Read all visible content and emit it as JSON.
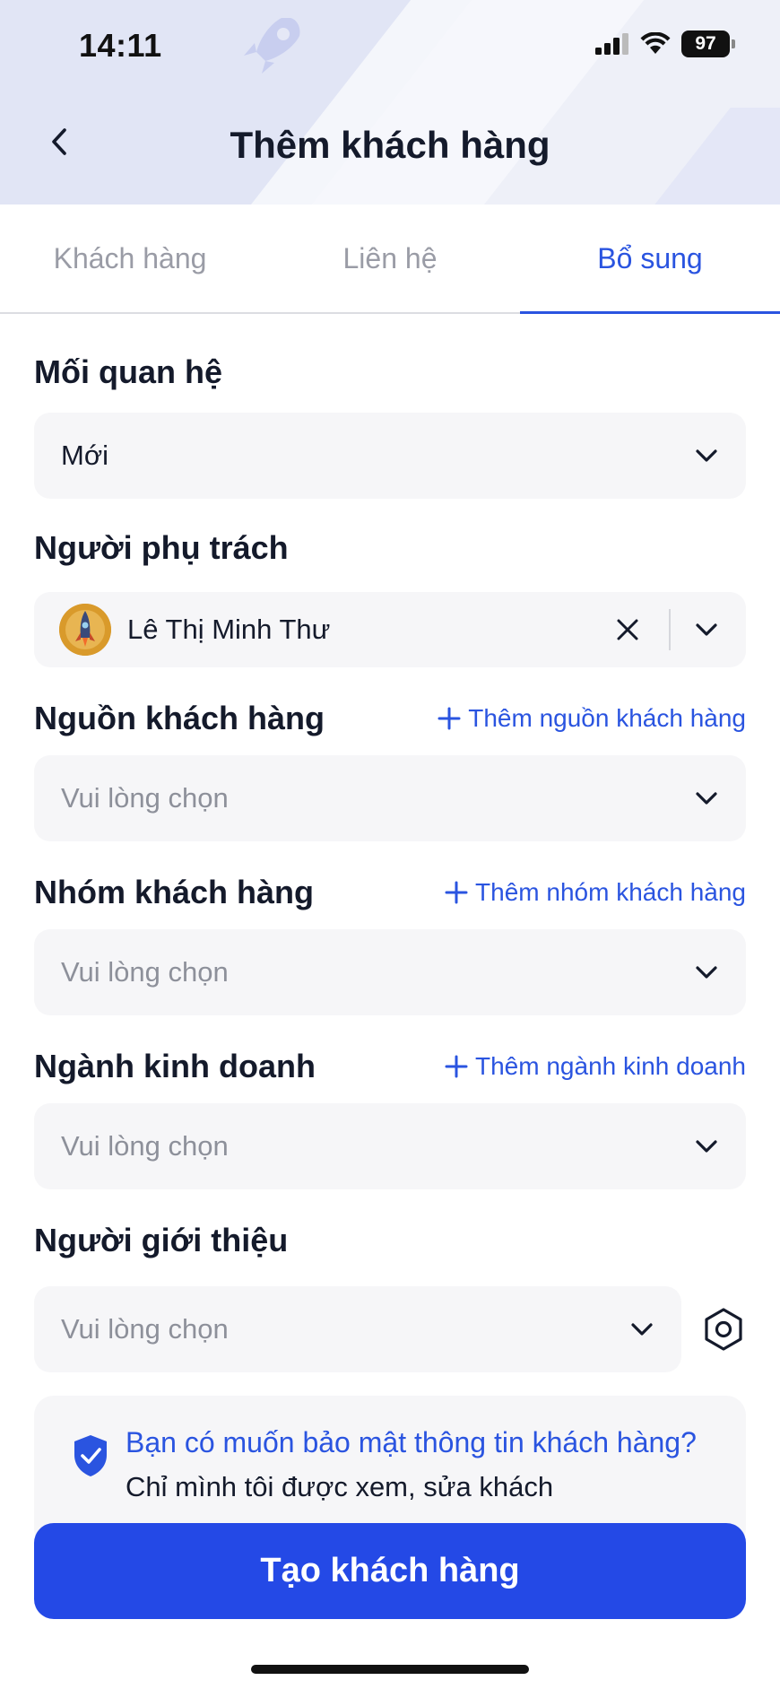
{
  "status_bar": {
    "time": "14:11",
    "battery": "97"
  },
  "header": {
    "title": "Thêm khách hàng"
  },
  "tabs": [
    {
      "label": "Khách hàng",
      "active": false
    },
    {
      "label": "Liên hệ",
      "active": false
    },
    {
      "label": "Bổ sung",
      "active": true
    }
  ],
  "form": {
    "relationship": {
      "label": "Mối quan hệ",
      "value": "Mới"
    },
    "owner": {
      "label": "Người phụ trách",
      "value": "Lê Thị Minh Thư"
    },
    "source": {
      "label": "Nguồn khách hàng",
      "add_label": "Thêm nguồn khách hàng",
      "placeholder": "Vui lòng chọn"
    },
    "group": {
      "label": "Nhóm khách hàng",
      "add_label": "Thêm nhóm khách hàng",
      "placeholder": "Vui lòng chọn"
    },
    "industry": {
      "label": "Ngành kinh doanh",
      "add_label": "Thêm ngành kinh doanh",
      "placeholder": "Vui lòng chọn"
    },
    "referrer": {
      "label": "Người giới thiệu",
      "placeholder": "Vui lòng chọn"
    }
  },
  "privacy": {
    "question": "Bạn có muốn bảo mật thông tin khách hàng?",
    "description": "Chỉ mình tôi được xem, sửa khách",
    "checked": true
  },
  "actions": {
    "create_label": "Tạo khách hàng"
  },
  "colors": {
    "accent": "#2a54e0",
    "primary_button": "#2449e6",
    "field_bg": "#f6f6f8"
  }
}
